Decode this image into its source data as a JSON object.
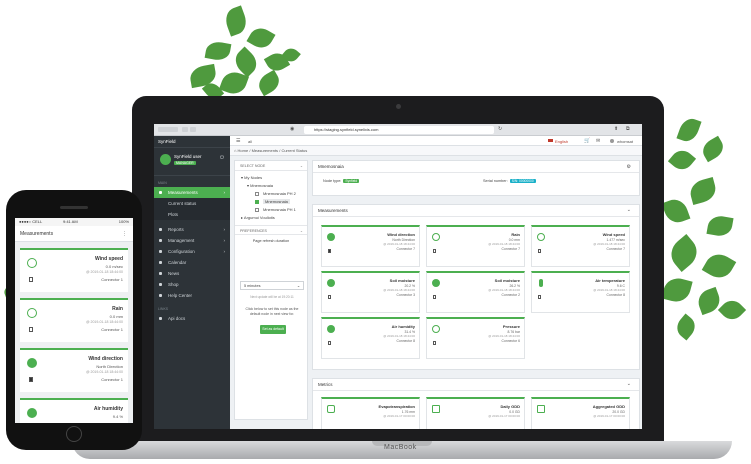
{
  "browser": {
    "url": "https://staging.synfield.synelixis.com"
  },
  "app": {
    "logo": "SynField",
    "user_name": "SynField user",
    "user_role": "MANAGER",
    "language": "English",
    "account": "whomsat"
  },
  "sidebar": {
    "section_main": "MAIN",
    "items": [
      {
        "label": "Measurements",
        "active": true
      },
      {
        "label": "Current status"
      },
      {
        "label": "Plots"
      },
      {
        "label": "Reports"
      },
      {
        "label": "Management"
      },
      {
        "label": "Configuration"
      },
      {
        "label": "Calendar"
      },
      {
        "label": "News"
      },
      {
        "label": "Shop"
      },
      {
        "label": "Help Center"
      }
    ],
    "section_links": "LINKS",
    "api_docs": "Api docs"
  },
  "breadcrumb": {
    "home": "Home",
    "sep1": "/",
    "measurements": "Measurements",
    "sep2": "/",
    "current": "Current Status",
    "zoom": "all"
  },
  "node_panel": {
    "select_node": "SELECT NODE",
    "my_nodes": "My Nodes",
    "group": "Mnemosnaia",
    "nodes": [
      "Mnemosnaia PH 2",
      "Mnemosnaia",
      "Mnemosnaia PH 1"
    ],
    "other_group": "Argumui Vouliotis",
    "preferences": "PREFERENCES",
    "refresh_label": "Page refresh duration",
    "refresh_value": "5 minutes",
    "last_update": "Next update will be at 19:20:11",
    "hint": "Click below to set this node as the default node in next view for.",
    "set_default": "Set as default"
  },
  "node_header": {
    "title": "Mnemosnaia",
    "node_type_label": "Node type:",
    "node_type": "Synfield",
    "serial_label": "Serial number:",
    "serial": "S/N: 00000000"
  },
  "measurements": {
    "title": "Measurements",
    "tiles": [
      {
        "title": "Wind direction",
        "value": "North Direction",
        "date": "@ 2019-01-18 18:44:00",
        "connector": "Connector 7"
      },
      {
        "title": "Rain",
        "value": "0.0 mm",
        "date": "@ 2019-01-18 18:44:00",
        "connector": "Connector 7"
      },
      {
        "title": "Wind speed",
        "value": "1.477 m/sec",
        "date": "@ 2019-01-18 18:44:00",
        "connector": "Connector 7"
      },
      {
        "title": "Soil moisture",
        "value": "20.2 %",
        "date": "@ 2019-01-18 18:44:00",
        "connector": "Connector 3"
      },
      {
        "title": "Soil moisture",
        "value": "26.2 %",
        "date": "@ 2019-01-18 18:44:00",
        "connector": "Connector 2"
      },
      {
        "title": "Air temperature",
        "value": "9.6 C",
        "date": "@ 2019-01-18 18:44:00",
        "connector": "Connector 8"
      },
      {
        "title": "Air humidity",
        "value": "31.4 %",
        "date": "@ 2019-01-18 18:44:00",
        "connector": "Connector 8"
      },
      {
        "title": "Pressure",
        "value": "8.76 bar",
        "date": "@ 2019-01-18 18:44:00",
        "connector": "Connector 6"
      }
    ]
  },
  "metrics": {
    "title": "Metrics",
    "tiles": [
      {
        "title": "Evapotranspiration",
        "value": "1.76 mm",
        "date": "@ 2019-01-17 00:00:00"
      },
      {
        "title": "Daily GDD",
        "value": "0.0 GD",
        "date": "@ 2019-01-17 00:00:00"
      },
      {
        "title": "Aggregated GDD",
        "value": "20.0 GD",
        "date": "@ 2019-01-17 00:00:00"
      }
    ]
  },
  "phone": {
    "carrier": "●●●●○ CELL",
    "time": "9:41 AM",
    "battery": "100%",
    "title": "Measurements",
    "cards": [
      {
        "title": "Wind speed",
        "value": "0.0 m/sec",
        "date": "@ 2019-01-18 18:44:00",
        "connector": "Connector 1"
      },
      {
        "title": "Rain",
        "value": "0.0 mm",
        "date": "@ 2019-01-18 18:44:00",
        "connector": "Connector 1"
      },
      {
        "title": "Wind direction",
        "value": "North Direction",
        "date": "@ 2019-01-18 18:44:00",
        "connector": "Connector 1"
      },
      {
        "title": "Air humidity",
        "value": "9.4 %"
      }
    ]
  },
  "device": {
    "brand": "MacBook"
  },
  "colors": {
    "accent": "#4caf50",
    "sidebar": "#2d3338",
    "teal_badge": "#19b0c8"
  }
}
